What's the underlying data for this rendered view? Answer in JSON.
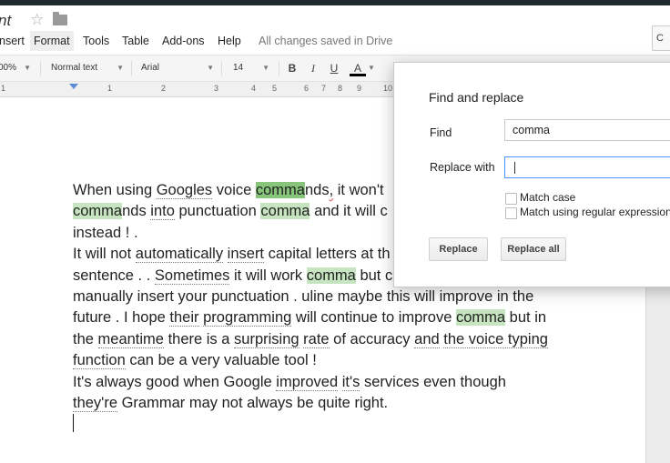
{
  "document": {
    "title_fragment": "nt"
  },
  "menu": {
    "items": [
      "nsert",
      "Format",
      "Tools",
      "Table",
      "Add-ons",
      "Help"
    ],
    "status": "All changes saved in Drive"
  },
  "toolbar": {
    "zoom": "00%",
    "style": "Normal text",
    "font": "Arial",
    "size": "14",
    "bold": "B",
    "italic": "I",
    "underline": "U",
    "text_color": "A"
  },
  "ruler": {
    "labels": [
      "1",
      "1",
      "2",
      "3",
      "4",
      "5",
      "6",
      "7",
      "8",
      "9",
      "10"
    ]
  },
  "find_replace": {
    "title": "Find and replace",
    "find_label": "Find",
    "find_value": "comma",
    "replace_label": "Replace with",
    "replace_value": "",
    "match_case_label": "Match case",
    "regex_label": "Match using regular expression",
    "replace_button": "Replace",
    "replace_all_button": "Replace all"
  },
  "colors": {
    "highlight": "#c6e4c0",
    "current_highlight": "#86c57a",
    "focus_border": "#4d90fe"
  },
  "body_lines": [
    [
      {
        "t": "When using "
      },
      {
        "t": "Googles",
        "c": "ul"
      },
      {
        "t": " voice "
      },
      {
        "t": "comma",
        "c": "hl-cur"
      },
      {
        "t": "nds"
      },
      {
        "t": ",",
        "c": "sp"
      },
      {
        "t": " it won't"
      }
    ],
    [
      {
        "t": "comma",
        "c": "hl"
      },
      {
        "t": "nds "
      },
      {
        "t": "into",
        "c": "ul"
      },
      {
        "t": " punctuation "
      },
      {
        "t": "comma",
        "c": "hl"
      },
      {
        "t": " and  it will c"
      }
    ],
    [
      {
        "t": "instead  ! ."
      }
    ],
    [
      {
        "t": "It will not "
      },
      {
        "t": "automatically",
        "c": "ul"
      },
      {
        "t": " "
      },
      {
        "t": "insert",
        "c": "ul"
      },
      {
        "t": " capital letters at th"
      }
    ],
    [
      {
        "t": "sentence . . "
      },
      {
        "t": "Sometimes",
        "c": "ul"
      },
      {
        "t": " it will work "
      },
      {
        "t": "comma",
        "c": "hl"
      },
      {
        "t": " but c"
      }
    ],
    [
      {
        "t": "manually insert your punctuation . uline maybe this will improve in the"
      }
    ],
    [
      {
        "t": "future . I hope "
      },
      {
        "t": "their",
        "c": "ul"
      },
      {
        "t": " "
      },
      {
        "t": "programming",
        "c": "ul"
      },
      {
        "t": " will continue to improve "
      },
      {
        "t": "comma",
        "c": "hl"
      },
      {
        "t": " but in"
      }
    ],
    [
      {
        "t": "the "
      },
      {
        "t": "meantime",
        "c": "ul"
      },
      {
        "t": " there is a "
      },
      {
        "t": "surprising",
        "c": "ul"
      },
      {
        "t": " "
      },
      {
        "t": "rate",
        "c": "ul"
      },
      {
        "t": " of accuracy "
      },
      {
        "t": "and",
        "c": "ul"
      },
      {
        "t": "  "
      },
      {
        "t": "the voice typing",
        "c": "ul"
      }
    ],
    [
      {
        "t": "function",
        "c": "ul"
      },
      {
        "t": " can be a very valuable tool !"
      }
    ],
    [
      {
        "t": "It's always good when Google "
      },
      {
        "t": "improved",
        "c": "ul"
      },
      {
        "t": " "
      },
      {
        "t": "it's",
        "c": "ul"
      },
      {
        "t": " services even though"
      }
    ],
    [
      {
        "t": "they're",
        "c": "ul"
      },
      {
        "t": " Grammar may not always be  quite right."
      }
    ]
  ]
}
